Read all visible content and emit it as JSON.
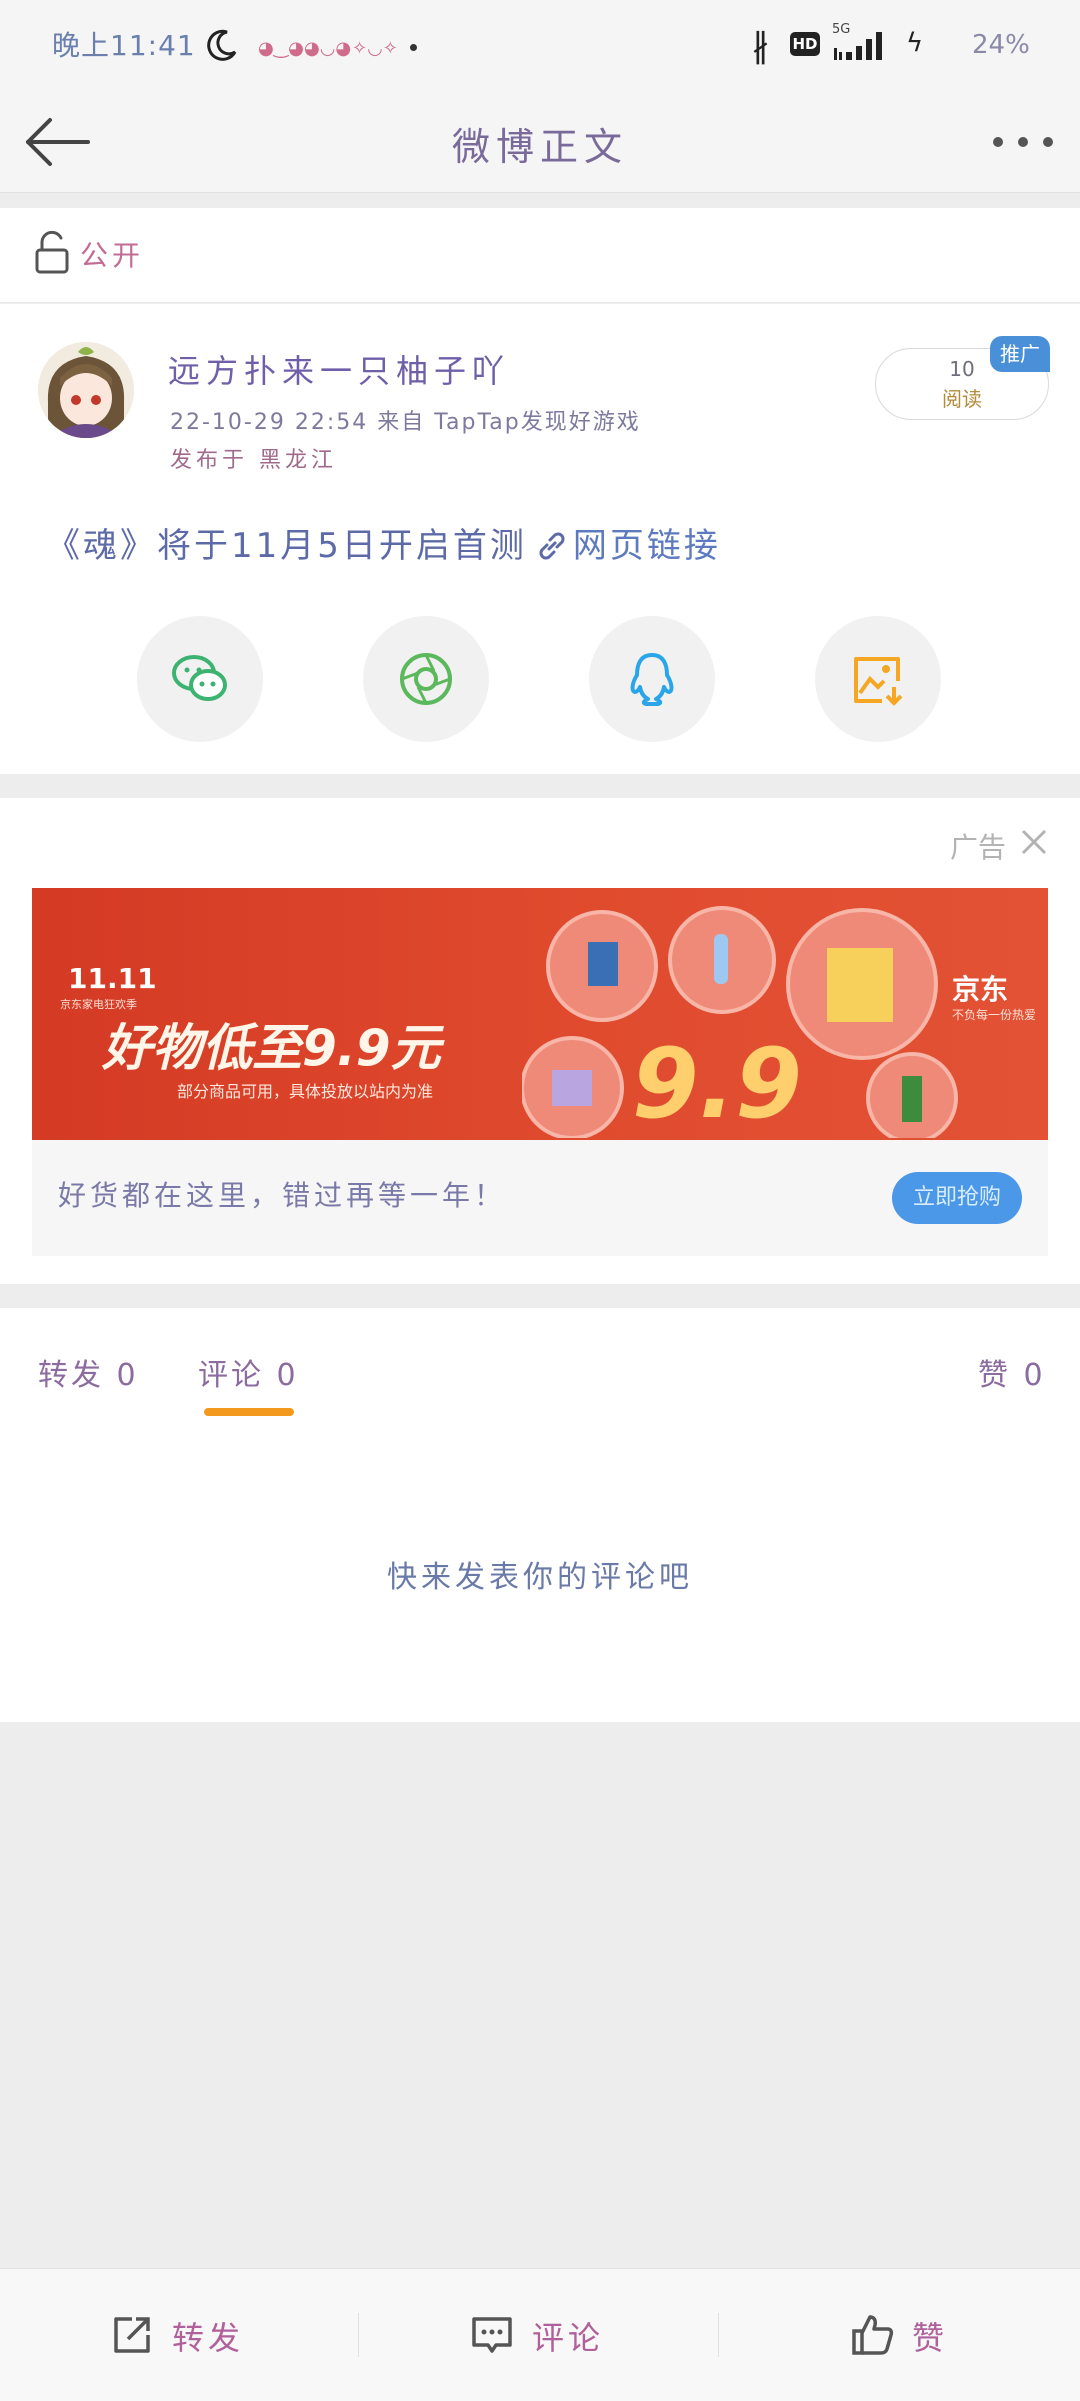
{
  "status_bar": {
    "time": "晚上11:41",
    "network": "5G",
    "hd": "HD",
    "battery": "24%"
  },
  "nav": {
    "title": "微博正文",
    "back_icon": "arrow-left-icon",
    "more_icon": "more-dots-icon"
  },
  "visibility": {
    "label": "公开",
    "icon": "unlock-icon"
  },
  "post": {
    "username": "远方扑来一只柚子吖",
    "datetime_source": "22-10-29 22:54  来自 TapTap发现好游戏",
    "location": "发布于 黑龙江",
    "read_count": "10",
    "read_label": "阅读",
    "promo_badge": "推广",
    "content_text": "《魂》将于11月5日开启首测",
    "link_text": "网页链接"
  },
  "share_buttons": [
    {
      "name": "wechat",
      "icon": "wechat-icon",
      "color": "#3cb371"
    },
    {
      "name": "moments",
      "icon": "moments-icon",
      "color": "#5cb85c"
    },
    {
      "name": "qq",
      "icon": "qq-icon",
      "color": "#2aa5e8"
    },
    {
      "name": "save-image",
      "icon": "save-image-icon",
      "color": "#f5a623"
    }
  ],
  "ad": {
    "label": "广告",
    "banner": {
      "event": "11.11",
      "event_sub": "京东家电狂欢季",
      "headline": "好物低至9.9元",
      "subline": "部分商品可用，具体投放以站内为准",
      "big_number": "9.9",
      "brand": "京东",
      "brand_sub": "不负每一份热爱"
    },
    "caption": "好货都在这里，错过再等一年！",
    "cta": "立即抢购"
  },
  "tabs": {
    "repost": "转发 0",
    "comment": "评论 0",
    "like": "赞 0"
  },
  "comments": {
    "empty_text": "快来发表你的评论吧"
  },
  "bottom_bar": {
    "repost": "转发",
    "comment": "评论",
    "like": "赞"
  },
  "colors": {
    "accent": "#f39a1e",
    "ad_banner": "#d43a24",
    "cta": "#4b97e8"
  }
}
